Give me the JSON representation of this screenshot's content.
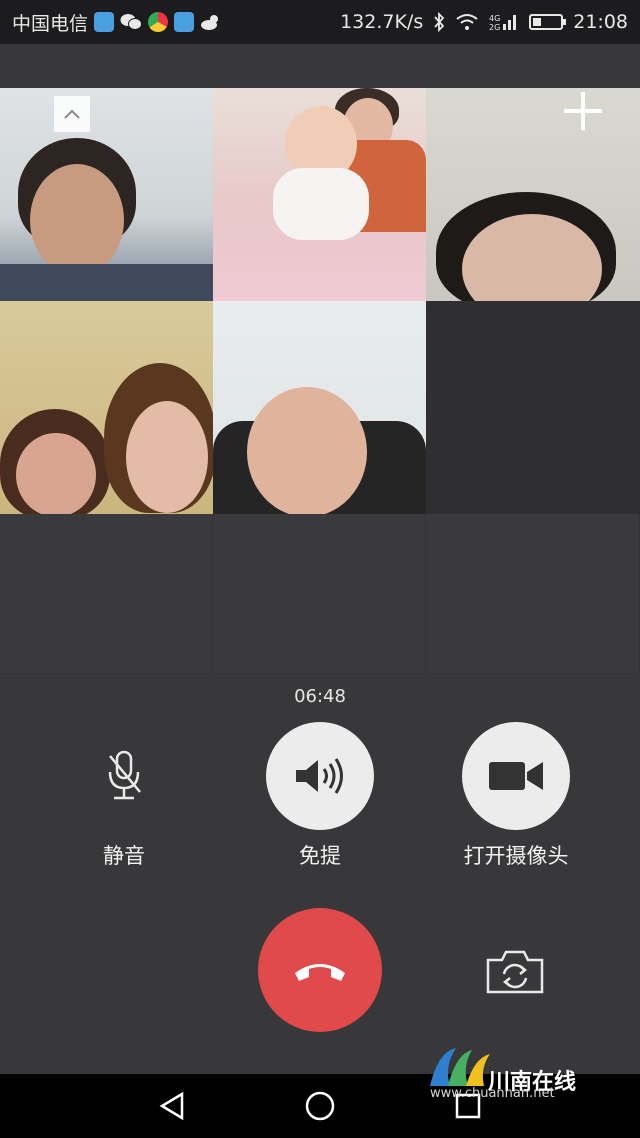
{
  "status_bar": {
    "carrier": "中国电信",
    "network_speed": "132.7K/s",
    "network_type": "4G 2G",
    "time": "21:08",
    "icons": [
      "app-icon",
      "wechat-icon",
      "chrome-icon",
      "app-icon",
      "weather-icon",
      "bluetooth-icon",
      "wifi-icon",
      "signal-icon",
      "battery-icon"
    ]
  },
  "call": {
    "duration": "06:48",
    "controls": {
      "mute_label": "静音",
      "speaker_label": "免提",
      "camera_label": "打开摄像头"
    }
  },
  "watermark": {
    "title": "川南在线",
    "url": "www.chuannan.net"
  },
  "colors": {
    "background": "#38383a",
    "hangup": "#e04a4a",
    "control_button": "#ececec"
  },
  "navigation": {
    "icons": [
      "back-icon",
      "home-icon",
      "recents-icon"
    ]
  }
}
